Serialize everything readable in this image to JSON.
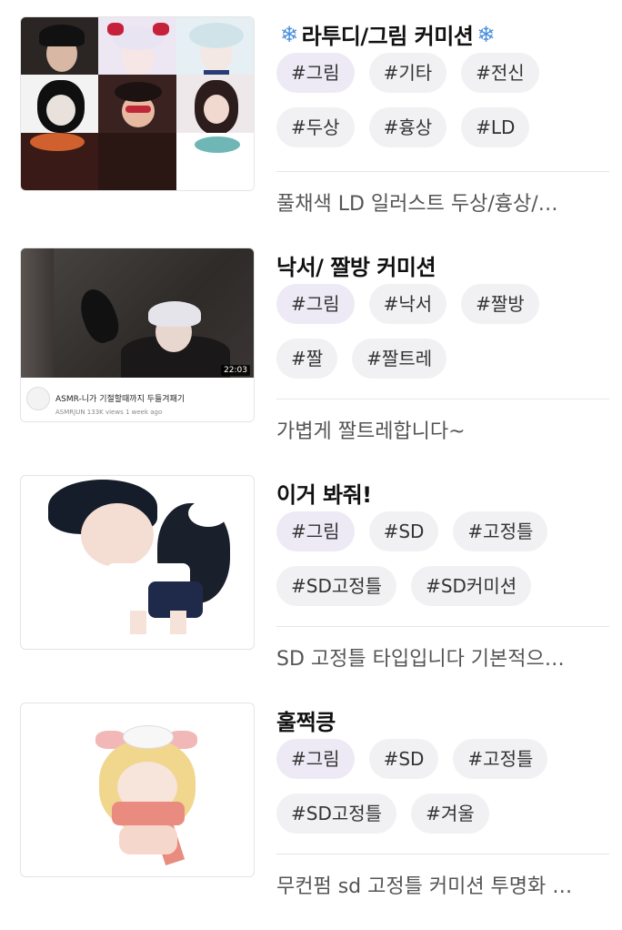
{
  "items": [
    {
      "title": "라투디/그림 커미션",
      "title_prefix_icon": "snowflake-icon",
      "title_suffix_icon": "snowflake-icon",
      "tags": [
        "#그림",
        "#기타",
        "#전신",
        "#두상",
        "#흉상",
        "#LD"
      ],
      "description": "풀채색 LD 일러스트 두상/흉상/…",
      "thumbnail": "character-illustration-grid"
    },
    {
      "title": "낙서/ 짤방 커미션",
      "tags": [
        "#그림",
        "#낙서",
        "#짤방",
        "#짤",
        "#짤트레"
      ],
      "description": "가볍게 짤트레합니다~",
      "thumbnail": "video-screenshot",
      "video": {
        "duration": "22:03",
        "title": "ASMR-니가 기절할때까지 두들겨패기",
        "meta": "ASMRJUN 133K views 1 week ago"
      }
    },
    {
      "title": "이거 봐줘!",
      "tags": [
        "#그림",
        "#SD",
        "#고정틀",
        "#SD고정틀",
        "#SD커미션"
      ],
      "description": "SD 고정틀 타입입니다 기본적으…",
      "thumbnail": "sd-character-schoolboy"
    },
    {
      "title": "훌쩍킁",
      "tags": [
        "#그림",
        "#SD",
        "#고정틀",
        "#SD고정틀",
        "#겨울"
      ],
      "description": "무컨펌 sd 고정틀 커미션 투명화 …",
      "thumbnail": "sd-character-winter-girl"
    }
  ],
  "colors": {
    "first_tag_bg": "#eeeaf5",
    "tag_bg": "#f1f1f3",
    "snowflake": "#4a90d9"
  }
}
